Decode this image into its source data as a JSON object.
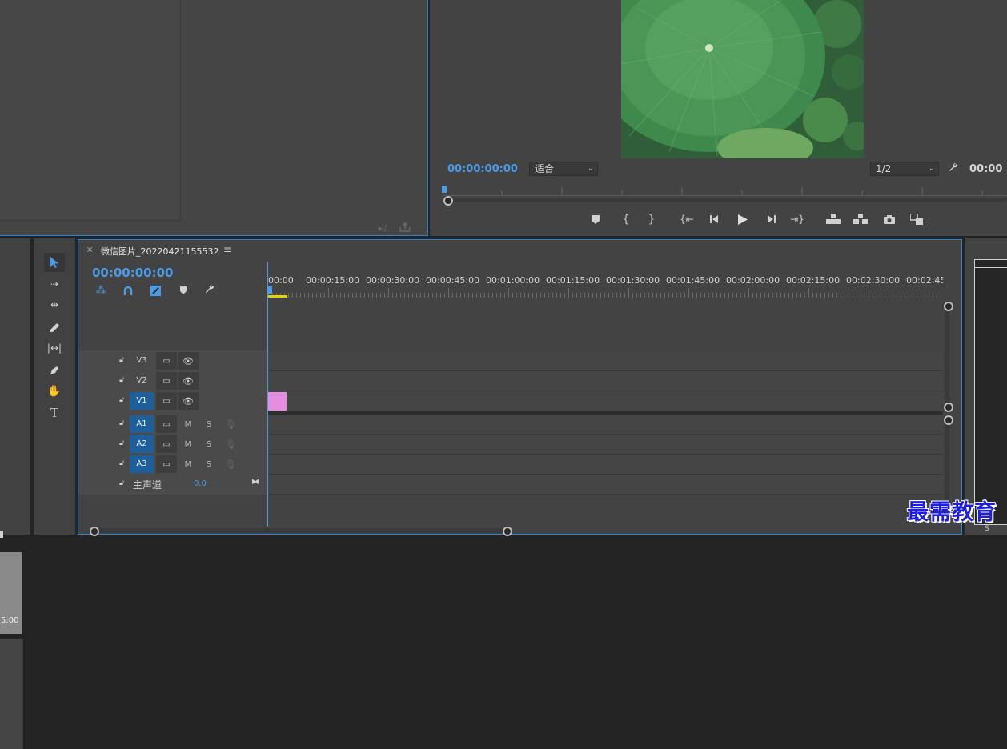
{
  "program_monitor": {
    "timecode_left": "00:00:00:00",
    "fit_dropdown": "适合",
    "resolution_dropdown": "1/2",
    "timecode_right": "00:00"
  },
  "timeline": {
    "sequence_name": "微信图片_20220421155532",
    "timecode": "00:00:00:00",
    "ruler": [
      "00:00",
      "00:00:15:00",
      "00:00:30:00",
      "00:00:45:00",
      "00:01:00:00",
      "00:01:15:00",
      "00:01:30:00",
      "00:01:45:00",
      "00:02:00:00",
      "00:02:15:00",
      "00:02:30:00",
      "00:02:45:"
    ],
    "video_tracks": [
      "V3",
      "V2",
      "V1"
    ],
    "audio_tracks": [
      "A1",
      "A2",
      "A3"
    ],
    "mute_label": "M",
    "solo_label": "S",
    "master_label": "主声道",
    "master_value": "0.0"
  },
  "left_panel": {
    "time_fragment": "5:00"
  },
  "right_edge": {
    "s_label": "S"
  },
  "watermark": "最需教育",
  "colors": {
    "accent_blue": "#4c9be8",
    "clip_pink": "#e58ee0",
    "track_on": "#1f5f99"
  }
}
